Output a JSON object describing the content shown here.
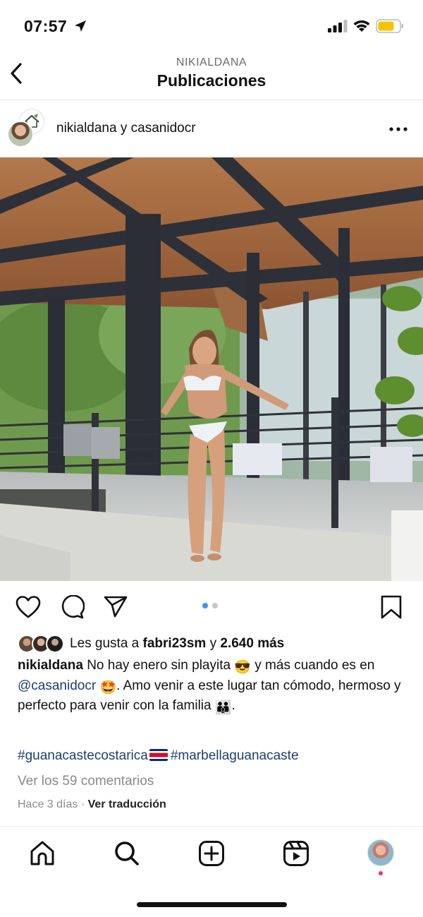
{
  "status_bar": {
    "time": "07:57",
    "icons": [
      "location-arrow-icon",
      "cellular-signal-icon",
      "wifi-icon",
      "battery-icon"
    ],
    "battery_color": "#f5c400"
  },
  "header": {
    "username": "NIKIALDANA",
    "title": "Publicaciones",
    "back_icon": "chevron-left-icon"
  },
  "post": {
    "authors_user": "nikialdana",
    "authors_joiner": " y ",
    "authors_collab": "casanidocr",
    "more_icon": "ellipsis-icon",
    "carousel_dots": {
      "count": 2,
      "active": 1,
      "active_color": "#3897f0",
      "inactive_color": "#c7c7c7"
    },
    "actions": [
      "heart-icon",
      "comment-icon",
      "share-icon",
      "bookmark-icon"
    ],
    "likes": {
      "prefix": "Les gusta a ",
      "user": "fabri23sm",
      "joiner": " y ",
      "count_text": "2.640 más"
    },
    "caption": {
      "username": "nikialdana",
      "text_1": " No hay enero sin playita ",
      "emoji_1": "😎",
      "text_2": " y más cuando es en ",
      "mention": "@casanidocr",
      "emoji_2": "🤩",
      "text_3": ". Amo venir a este lugar tan cómodo, hermoso y perfecto para venir con la familia ",
      "emoji_3": "👪",
      "text_4": "."
    },
    "hashtag_1": "#guanacastecostarica",
    "hashtag_2": "#marbellaguanacaste",
    "comments_link": "Ver los 59 comentarios",
    "time_ago": "Hace 3 días",
    "separator": " · ",
    "translate": "Ver traducción"
  },
  "tab_bar": {
    "items": [
      "home-icon",
      "search-icon",
      "create-icon",
      "reels-icon",
      "profile-avatar"
    ],
    "notification_color": "#ff2d55"
  },
  "colors": {
    "link": "#1c3f6e",
    "secondary_text": "#8a8a8a"
  }
}
